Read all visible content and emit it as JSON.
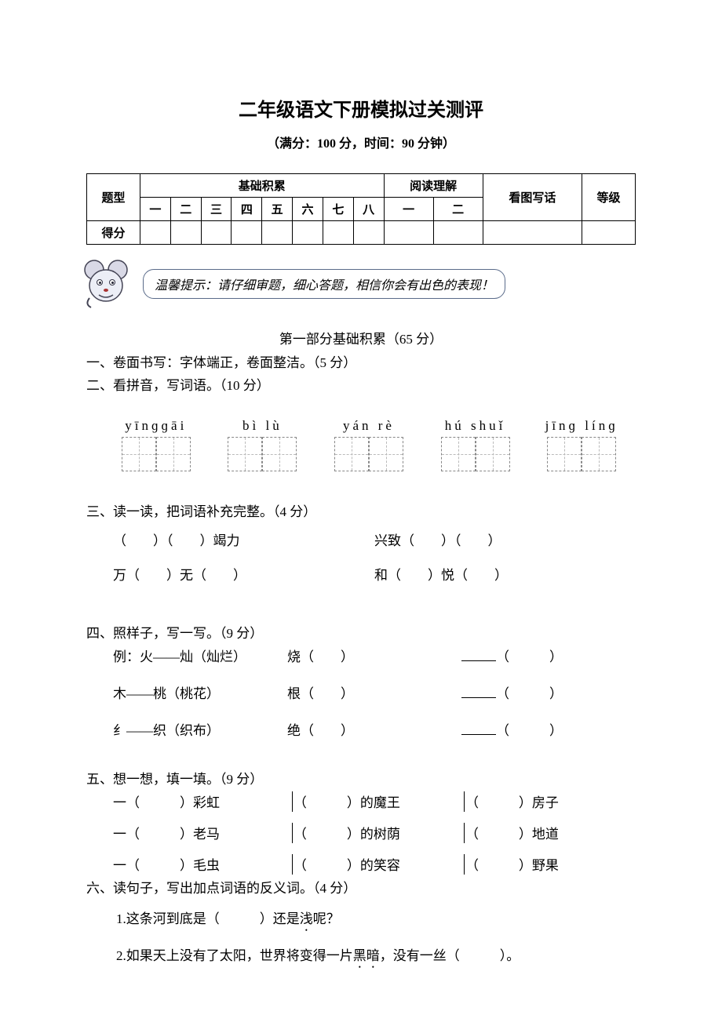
{
  "title": "二年级语文下册模拟过关测评",
  "subtitle": "（满分：100 分，时间：90 分钟）",
  "score_table": {
    "row1": {
      "c0": "题型",
      "group1": "基础积累",
      "group2": "阅读理解",
      "group3": "看图写话",
      "group4": "等级"
    },
    "row2": {
      "h1": "一",
      "h2": "二",
      "h3": "三",
      "h4": "四",
      "h5": "五",
      "h6": "六",
      "h7": "七",
      "h8": "八",
      "r1": "一",
      "r2": "二"
    },
    "row3": {
      "label": "得分"
    }
  },
  "tip": "温馨提示：请仔细审题，细心答题，相信你会有出色的表现！",
  "part1_title": "第一部分基础积累（65 分）",
  "q1": "一、卷面书写：字体端正，卷面整洁。（5 分）",
  "q2": {
    "title": "二、看拼音，写词语。（10 分）",
    "items": [
      {
        "pinyin": "yīnɡɡāi"
      },
      {
        "pinyin": "bì  lù"
      },
      {
        "pinyin": "yán rè"
      },
      {
        "pinyin": "hú shuǐ"
      },
      {
        "pinyin": "jīnɡ línɡ"
      }
    ]
  },
  "q3": {
    "title": "三、读一读，把词语补充完整。（4 分）",
    "r1a": "（　　）（　　）竭力",
    "r1b": "兴致（　　）（　　）",
    "r2a": "万（　　）无（　　）",
    "r2b": "和（　　）悦（　　）"
  },
  "q4": {
    "title": "四、照样子，写一写。（9 分）",
    "rows": [
      {
        "a": "例：火——灿（灿烂）",
        "b": "烧（　　）",
        "c_blank": "（　　　）"
      },
      {
        "a": "木——桃（桃花）",
        "b": "根（　　）",
        "c_blank": "（　　　）"
      },
      {
        "a": "纟——织（织布）",
        "b": "绝（　　）",
        "c_blank": "（　　　）"
      }
    ]
  },
  "q5": {
    "title": "五、想一想，填一填。（9 分）",
    "rows": [
      {
        "a": "一（　　　）彩虹",
        "b": "（　　　）的魔王",
        "c": "（　　　）房子"
      },
      {
        "a": "一（　　　）老马",
        "b": "（　　　）的树荫",
        "c": "（　　　）地道"
      },
      {
        "a": "一（　　　）毛虫",
        "b": "（　　　）的笑容",
        "c": "（　　　）野果"
      }
    ]
  },
  "q6": {
    "title": "六、读句子，写出加点词语的反义词。（4 分）",
    "s1_pre": "1.这条河到底是（　　　）还是",
    "s1_dot": "浅",
    "s1_post": "呢？",
    "s2_pre": "2.如果天上没有了太阳，世界将变得一片",
    "s2_dot": "黑暗",
    "s2_post": "，没有一丝（　　　）。"
  }
}
